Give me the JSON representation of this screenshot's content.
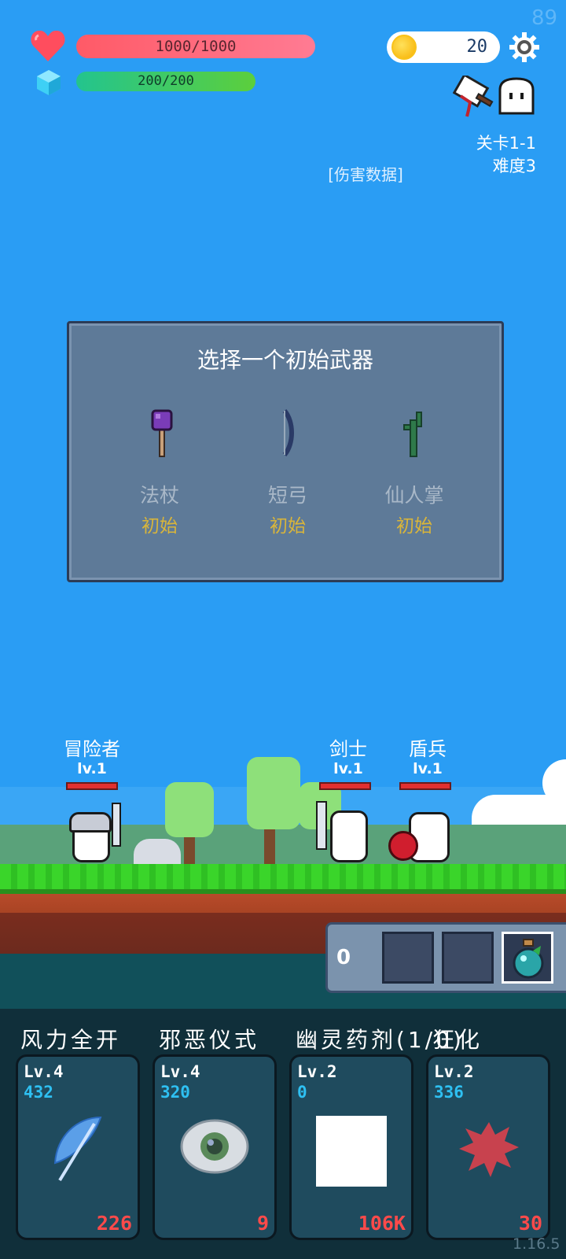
{
  "fps": "89",
  "hud": {
    "hp_text": "1000/1000",
    "hp_fraction": 1.0,
    "mp_text": "200/200",
    "mp_fraction": 1.0,
    "coins": "20",
    "stage": "关卡1-1",
    "difficulty": "难度3",
    "damage_data": "[伤害数据]"
  },
  "dialog": {
    "title": "选择一个初始武器",
    "weapons": [
      {
        "name": "法杖",
        "tag": "初始",
        "icon": "staff-icon"
      },
      {
        "name": "短弓",
        "tag": "初始",
        "icon": "bow-icon"
      },
      {
        "name": "仙人掌",
        "tag": "初始",
        "icon": "cactus-icon"
      }
    ]
  },
  "units": [
    {
      "name": "冒险者",
      "lv": "lv.1"
    },
    {
      "name": "剑士",
      "lv": "lv.1"
    },
    {
      "name": "盾兵",
      "lv": "lv.1"
    }
  ],
  "inventory": {
    "count": "0"
  },
  "skills": [
    {
      "name": "风力全开",
      "lv": "Lv.4",
      "dmg": "432",
      "cost": "226",
      "icon": "feather-icon"
    },
    {
      "name": "邪恶仪式",
      "lv": "Lv.4",
      "dmg": "320",
      "cost": "9",
      "icon": "eye-icon"
    },
    {
      "name": "幽灵药剂(1/0)",
      "lv": "Lv.2",
      "dmg": "0",
      "cost": "106K",
      "icon": "blank-square-icon"
    },
    {
      "name": "狂化",
      "lv": "Lv.2",
      "dmg": "336",
      "cost": "30",
      "icon": "blood-splat-icon"
    }
  ],
  "version": "1.16.5",
  "colors": {
    "sky": "#2a9df4",
    "hp": "#ff5a67",
    "mp": "#23c48e",
    "cost": "#ff4a4a",
    "dmg": "#2ec0f2"
  }
}
